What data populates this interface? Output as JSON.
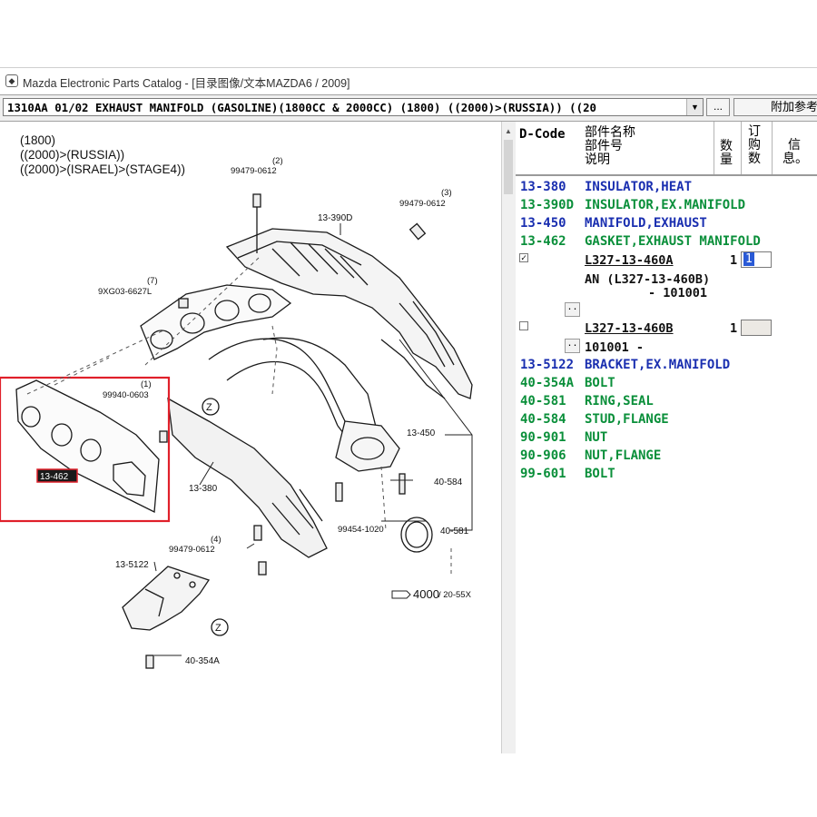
{
  "window": {
    "title": "Mazda Electronic Parts Catalog - [目录图像/文本MAZDA6 / 2009]"
  },
  "toolbar": {
    "section_value": "1310AA 01/02 EXHAUST MANIFOLD (GASOLINE)(1800CC & 2000CC) (1800) ((2000)>(RUSSIA)) ((20",
    "dots_label": "...",
    "extra_info_label": "附加参考"
  },
  "diagram": {
    "conditions": [
      "(1800)",
      "((2000)>(RUSSIA))",
      "((2000)>(ISRAEL)>(STAGE4))"
    ],
    "callouts": {
      "c390d": "13-390D",
      "c99479_2_num": "(2)",
      "c99479_2": "99479-0612",
      "c99479_3_num": "(3)",
      "c99479_3": "99479-0612",
      "c9xg03_num": "(7)",
      "c9xg03": "9XG03-6627L",
      "c99940_num": "(1)",
      "c99940": "99940-0603",
      "c13462": "13-462",
      "z1": "Z",
      "z2": "Z",
      "c13380": "13-380",
      "c13450": "13-450",
      "c40584": "40-584",
      "c99454": "99454-1020",
      "c40581": "40-581",
      "c99479_4_num": "(4)",
      "c99479_4": "99479-0612",
      "c135122": "13-5122",
      "c4000": "4000",
      "c2055x": "/ 20-55X",
      "c40354a": "40-354A"
    },
    "highlight_color": "#e0202a"
  },
  "parts": {
    "headers": {
      "dcode": "D-Code",
      "name_lines": [
        "部件名称",
        "部件号",
        "说明"
      ],
      "qty": [
        "数",
        "量"
      ],
      "order_qty": [
        "订",
        "购",
        "数"
      ],
      "info": [
        "信",
        "息。"
      ]
    },
    "rows_top": [
      {
        "code": "13-380",
        "desc": "INSULATOR,HEAT",
        "color": "blue"
      },
      {
        "code": "13-390D",
        "desc": "INSULATOR,EX.MANIFOLD",
        "color": "green"
      },
      {
        "code": "13-450",
        "desc": "MANIFOLD,EXHAUST",
        "color": "blue"
      },
      {
        "code": "13-462",
        "desc": "GASKET,EXHAUST MANIFOLD",
        "color": "green"
      }
    ],
    "variant_a": {
      "checked_mark": "✓",
      "part_no": "L327-13-460A",
      "qty": "1",
      "order_qty": "1",
      "note_line1": "AN (L327-13-460B)",
      "note_line2": "- 101001",
      "expand_label": ".."
    },
    "variant_b": {
      "part_no": "L327-13-460B",
      "qty": "1",
      "note_line1": "101001  -",
      "expand_label": ".."
    },
    "rows_bottom": [
      {
        "code": "13-5122",
        "desc": "BRACKET,EX.MANIFOLD",
        "color": "blue"
      },
      {
        "code": "40-354A",
        "desc": "BOLT",
        "color": "green"
      },
      {
        "code": "40-581",
        "desc": "RING,SEAL",
        "color": "green"
      },
      {
        "code": "40-584",
        "desc": "STUD,FLANGE",
        "color": "green"
      },
      {
        "code": "90-901",
        "desc": "NUT",
        "color": "green"
      },
      {
        "code": "90-906",
        "desc": "NUT,FLANGE",
        "color": "green"
      },
      {
        "code": "99-601",
        "desc": "BOLT",
        "color": "green"
      }
    ],
    "colors": {
      "blue": "#1a2fb0",
      "green": "#0a8f3a"
    }
  }
}
